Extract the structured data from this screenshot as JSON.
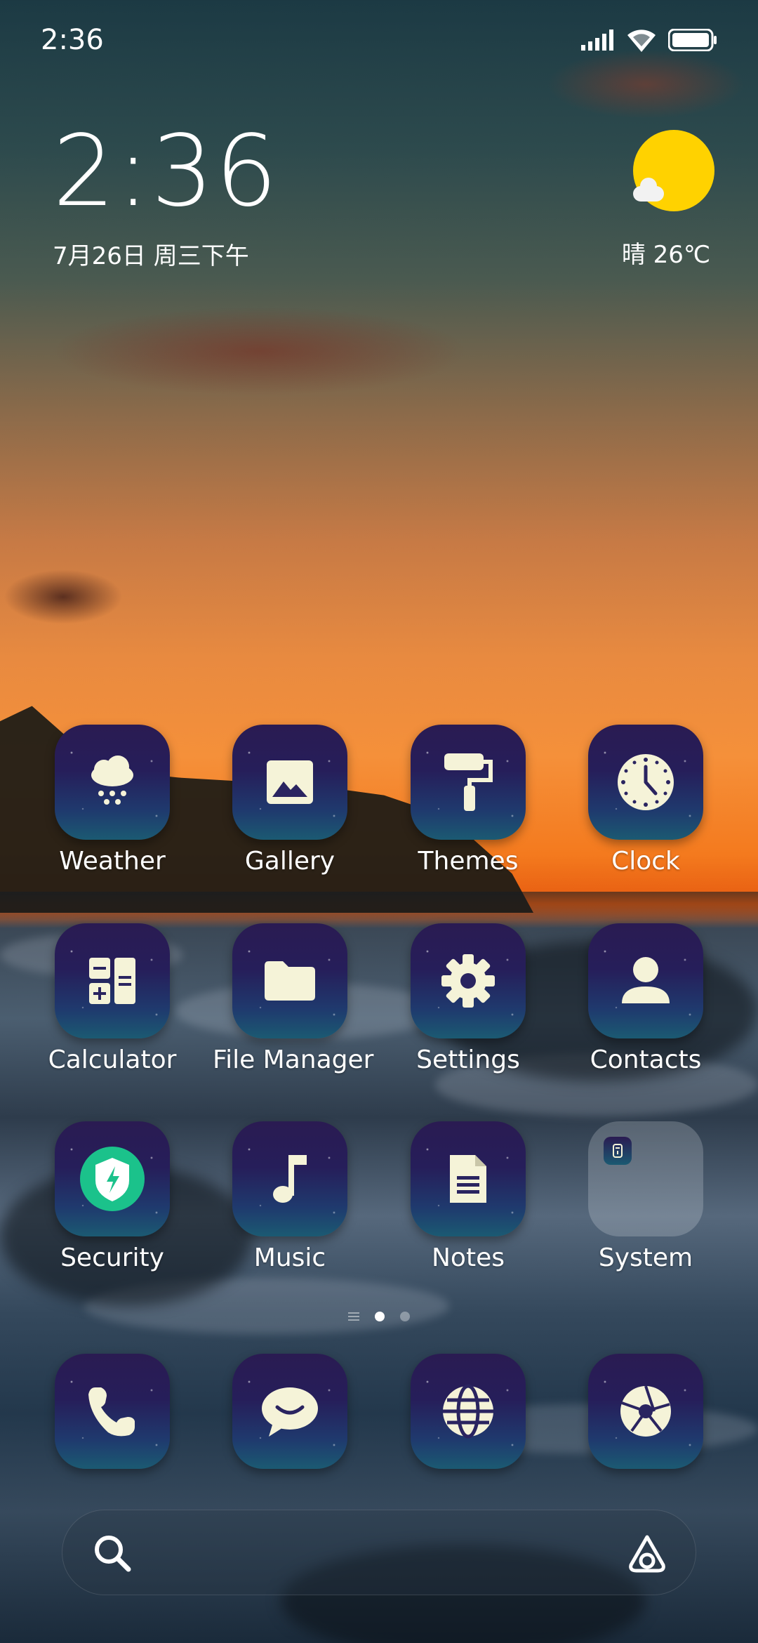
{
  "status_bar": {
    "time": "2:36"
  },
  "clock_widget": {
    "time": "2:36",
    "date": "7月26日 周三下午"
  },
  "weather_widget": {
    "text": "晴 26℃",
    "icon": "sun-cloud-icon",
    "sun_color": "#ffd200"
  },
  "apps": [
    {
      "label": "Weather",
      "icon": "weather-icon"
    },
    {
      "label": "Gallery",
      "icon": "gallery-icon"
    },
    {
      "label": "Themes",
      "icon": "themes-icon"
    },
    {
      "label": "Clock",
      "icon": "clock-icon"
    },
    {
      "label": "Calculator",
      "icon": "calculator-icon"
    },
    {
      "label": "File Manager",
      "icon": "folder-icon"
    },
    {
      "label": "Settings",
      "icon": "gear-icon"
    },
    {
      "label": "Contacts",
      "icon": "contacts-icon"
    },
    {
      "label": "Security",
      "icon": "shield-icon"
    },
    {
      "label": "Music",
      "icon": "music-note-icon"
    },
    {
      "label": "Notes",
      "icon": "notes-icon"
    },
    {
      "label": "System",
      "icon": "folder-group-icon"
    }
  ],
  "dock": [
    {
      "icon": "phone-icon"
    },
    {
      "icon": "messages-icon"
    },
    {
      "icon": "browser-icon"
    },
    {
      "icon": "camera-icon"
    }
  ],
  "page_indicator": {
    "pages": 2,
    "active": 1
  },
  "search_bar": {
    "left_icon": "search-icon",
    "right_icon": "assistant-icon"
  },
  "colors": {
    "icon_light": "#f5f3d8",
    "security_green": "#1bc28b"
  }
}
